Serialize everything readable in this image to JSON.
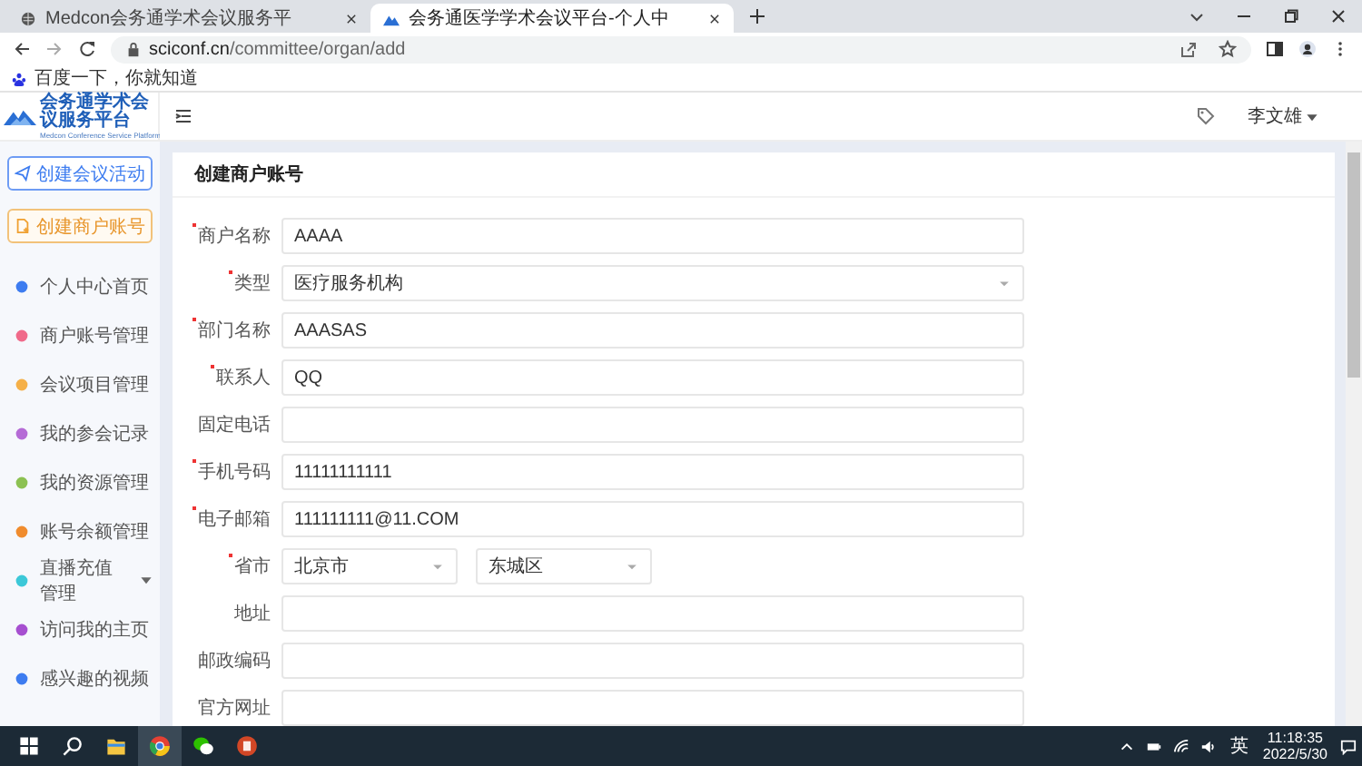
{
  "browser": {
    "tabs": [
      {
        "title": "Medcon会务通学术会议服务平",
        "selected": false
      },
      {
        "title": "会务通医学学术会议平台-个人中",
        "selected": true
      }
    ],
    "url_host": "sciconf.cn",
    "url_path": "/committee/organ/add",
    "bookmarks": [
      {
        "label": "百度一下，你就知道"
      }
    ]
  },
  "app": {
    "logo": {
      "title": "会务通学术会议服务平台",
      "subtitle": "Medcon Conference Service Platform"
    },
    "user": "李文雄"
  },
  "sidebar": {
    "actions": [
      {
        "label": "创建会议活动",
        "kind": "primary"
      },
      {
        "label": "创建商户账号",
        "kind": "warning"
      }
    ],
    "nav": [
      {
        "label": "个人中心首页",
        "color": "#3d7cf0",
        "submenu": false
      },
      {
        "label": "商户账号管理",
        "color": "#f06a8a",
        "submenu": false
      },
      {
        "label": "会议项目管理",
        "color": "#f5b048",
        "submenu": false
      },
      {
        "label": "我的参会记录",
        "color": "#b56bd6",
        "submenu": false
      },
      {
        "label": "我的资源管理",
        "color": "#8cc152",
        "submenu": false
      },
      {
        "label": "账号余额管理",
        "color": "#f08c2e",
        "submenu": false
      },
      {
        "label": "直播充值管理",
        "color": "#3cc8d8",
        "submenu": true
      },
      {
        "label": "访问我的主页",
        "color": "#a64fd0",
        "submenu": false
      },
      {
        "label": "感兴趣的视频",
        "color": "#3d7cf0",
        "submenu": false
      }
    ]
  },
  "form": {
    "title": "创建商户账号",
    "fields": [
      {
        "label": "商户名称",
        "required": true,
        "kind": "text",
        "value": "AAAA"
      },
      {
        "label": "类型",
        "required": true,
        "kind": "select",
        "value": "医疗服务机构"
      },
      {
        "label": "部门名称",
        "required": true,
        "kind": "text",
        "value": "AAASAS"
      },
      {
        "label": "联系人",
        "required": true,
        "kind": "text",
        "value": "QQ"
      },
      {
        "label": "固定电话",
        "required": false,
        "kind": "text"
      },
      {
        "label": "手机号码",
        "required": true,
        "kind": "text",
        "value": "11111111111"
      },
      {
        "label": "电子邮箱",
        "required": true,
        "kind": "text",
        "value": "111111111@11.COM"
      },
      {
        "label": "省市",
        "required": true,
        "kind": "region",
        "values": [
          "北京市",
          "东城区"
        ]
      },
      {
        "label": "地址",
        "required": false,
        "kind": "text"
      },
      {
        "label": "邮政编码",
        "required": false,
        "kind": "text"
      },
      {
        "label": "官方网址",
        "required": false,
        "kind": "text"
      }
    ]
  },
  "taskbar": {
    "ime": "英",
    "time": "11:18:35",
    "date": "2022/5/30"
  }
}
